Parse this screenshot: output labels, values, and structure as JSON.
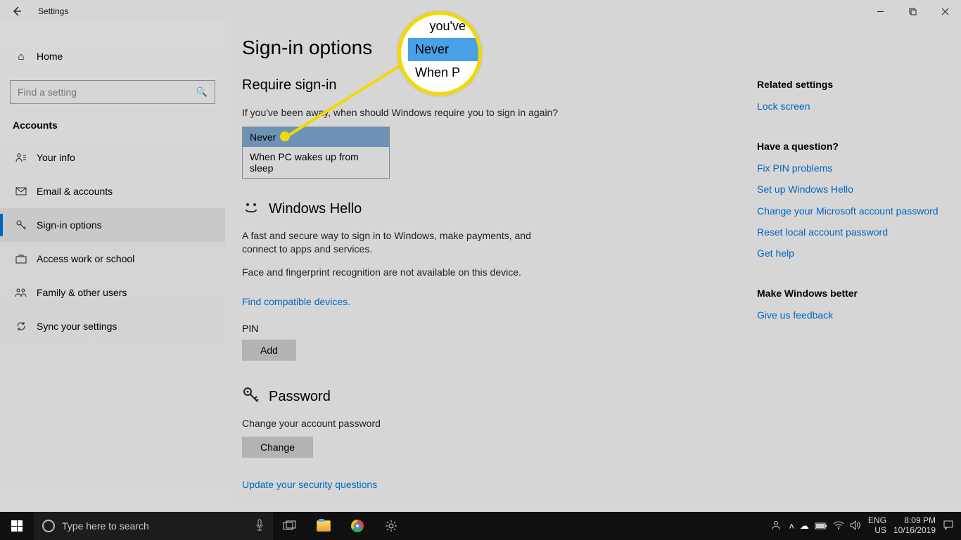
{
  "window": {
    "title": "Settings"
  },
  "sidebar": {
    "home": "Home",
    "search_placeholder": "Find a setting",
    "group": "Accounts",
    "items": [
      {
        "label": "Your info",
        "icon": "person"
      },
      {
        "label": "Email & accounts",
        "icon": "mail"
      },
      {
        "label": "Sign-in options",
        "icon": "key"
      },
      {
        "label": "Access work or school",
        "icon": "briefcase"
      },
      {
        "label": "Family & other users",
        "icon": "people"
      },
      {
        "label": "Sync your settings",
        "icon": "sync"
      }
    ]
  },
  "main": {
    "title": "Sign-in options",
    "require": {
      "header": "Require sign-in",
      "desc": "If you've been away, when should Windows require you to sign in again?",
      "options": [
        "Never",
        "When PC wakes up from sleep"
      ],
      "selected": "Never"
    },
    "hello": {
      "header": "Windows Hello",
      "desc1": "A fast and secure way to sign in to Windows, make payments, and connect to apps and services.",
      "desc2": "Face and fingerprint recognition are not available on this device.",
      "link": "Find compatible devices."
    },
    "pin": {
      "label": "PIN",
      "button": "Add"
    },
    "password": {
      "header": "Password",
      "desc": "Change your account password",
      "button": "Change",
      "link": "Update your security questions"
    }
  },
  "right": {
    "related": {
      "header": "Related settings",
      "links": [
        "Lock screen"
      ]
    },
    "question": {
      "header": "Have a question?",
      "links": [
        "Fix PIN problems",
        "Set up Windows Hello",
        "Change your Microsoft account password",
        "Reset local account password",
        "Get help"
      ]
    },
    "better": {
      "header": "Make Windows better",
      "links": [
        "Give us feedback"
      ]
    }
  },
  "callout": {
    "top": "you've",
    "mid": "Never",
    "bot": "When P"
  },
  "taskbar": {
    "search": "Type here to search",
    "lang1": "ENG",
    "lang2": "US",
    "time": "8:09 PM",
    "date": "10/16/2019"
  }
}
